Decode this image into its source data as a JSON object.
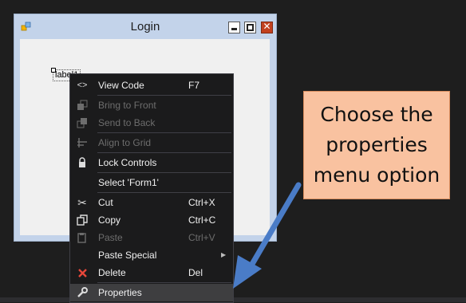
{
  "form": {
    "title": "Login",
    "label_text": "label1"
  },
  "context_menu": {
    "items": [
      {
        "label": "View Code",
        "shortcut": "F7",
        "icon": "code-icon",
        "enabled": true
      },
      {
        "label": "Bring to Front",
        "shortcut": "",
        "icon": "bring-to-front-icon",
        "enabled": false
      },
      {
        "label": "Send to Back",
        "shortcut": "",
        "icon": "send-to-back-icon",
        "enabled": false
      },
      {
        "label": "Align to Grid",
        "shortcut": "",
        "icon": "align-to-grid-icon",
        "enabled": false
      },
      {
        "label": "Lock Controls",
        "shortcut": "",
        "icon": "lock-icon",
        "enabled": true
      },
      {
        "label": "Select 'Form1'",
        "shortcut": "",
        "icon": "",
        "enabled": true
      },
      {
        "label": "Cut",
        "shortcut": "Ctrl+X",
        "icon": "scissors-icon",
        "enabled": true
      },
      {
        "label": "Copy",
        "shortcut": "Ctrl+C",
        "icon": "copy-icon",
        "enabled": true
      },
      {
        "label": "Paste",
        "shortcut": "Ctrl+V",
        "icon": "paste-icon",
        "enabled": false
      },
      {
        "label": "Paste Special",
        "shortcut": "",
        "icon": "",
        "enabled": true,
        "submenu": true
      },
      {
        "label": "Delete",
        "shortcut": "Del",
        "icon": "delete-icon",
        "enabled": true
      },
      {
        "label": "Properties",
        "shortcut": "",
        "icon": "wrench-icon",
        "enabled": true,
        "highlighted": true
      }
    ]
  },
  "callout": {
    "lines": [
      "Choose the",
      "properties",
      "menu option"
    ]
  },
  "colors": {
    "background": "#1e1e1e",
    "menu_background": "#1b1b1c",
    "callout_fill": "#f9c2a0",
    "arrow": "#4a7cc7",
    "delete_icon": "#e8473a"
  }
}
